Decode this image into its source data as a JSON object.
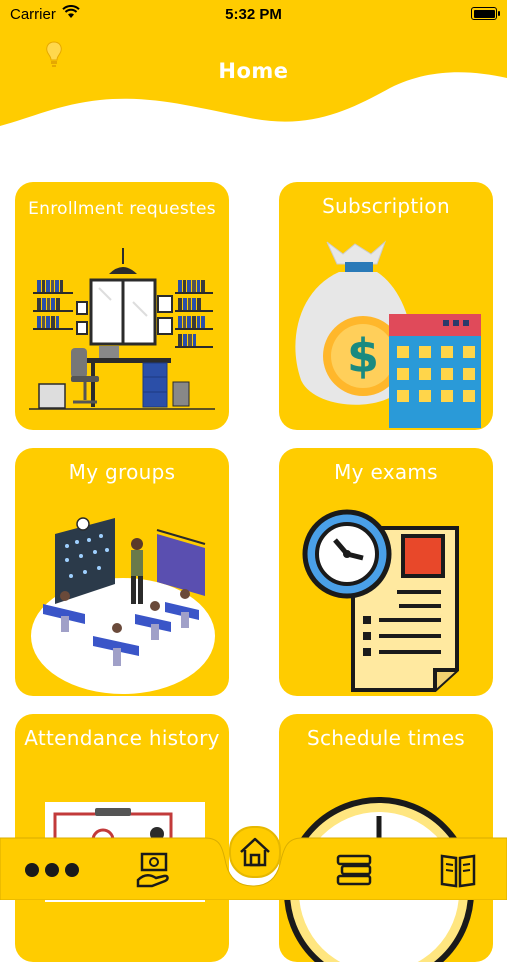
{
  "status_bar": {
    "carrier": "Carrier",
    "time": "5:32 PM"
  },
  "header": {
    "title": "Home",
    "background_color": "#FFCC00"
  },
  "cards": [
    {
      "label": "Enrollment requestes",
      "icon": "office-illustration"
    },
    {
      "label": "Subscription",
      "icon": "money-bag-calendar-icon"
    },
    {
      "label": "My groups",
      "icon": "classroom-illustration"
    },
    {
      "label": "My exams",
      "icon": "exam-clock-document-icon"
    },
    {
      "label": "Attendance history",
      "icon": "attendance-illustration"
    },
    {
      "label": "Schedule times",
      "icon": "clock-icon"
    }
  ],
  "nav": {
    "items": [
      "more-icon",
      "payment-icon",
      "home-icon",
      "books-stack-icon",
      "open-book-icon"
    ]
  },
  "colors": {
    "accent": "#FFCC00",
    "icon_dark": "#2b2b2b",
    "card_text": "#ffffff"
  }
}
